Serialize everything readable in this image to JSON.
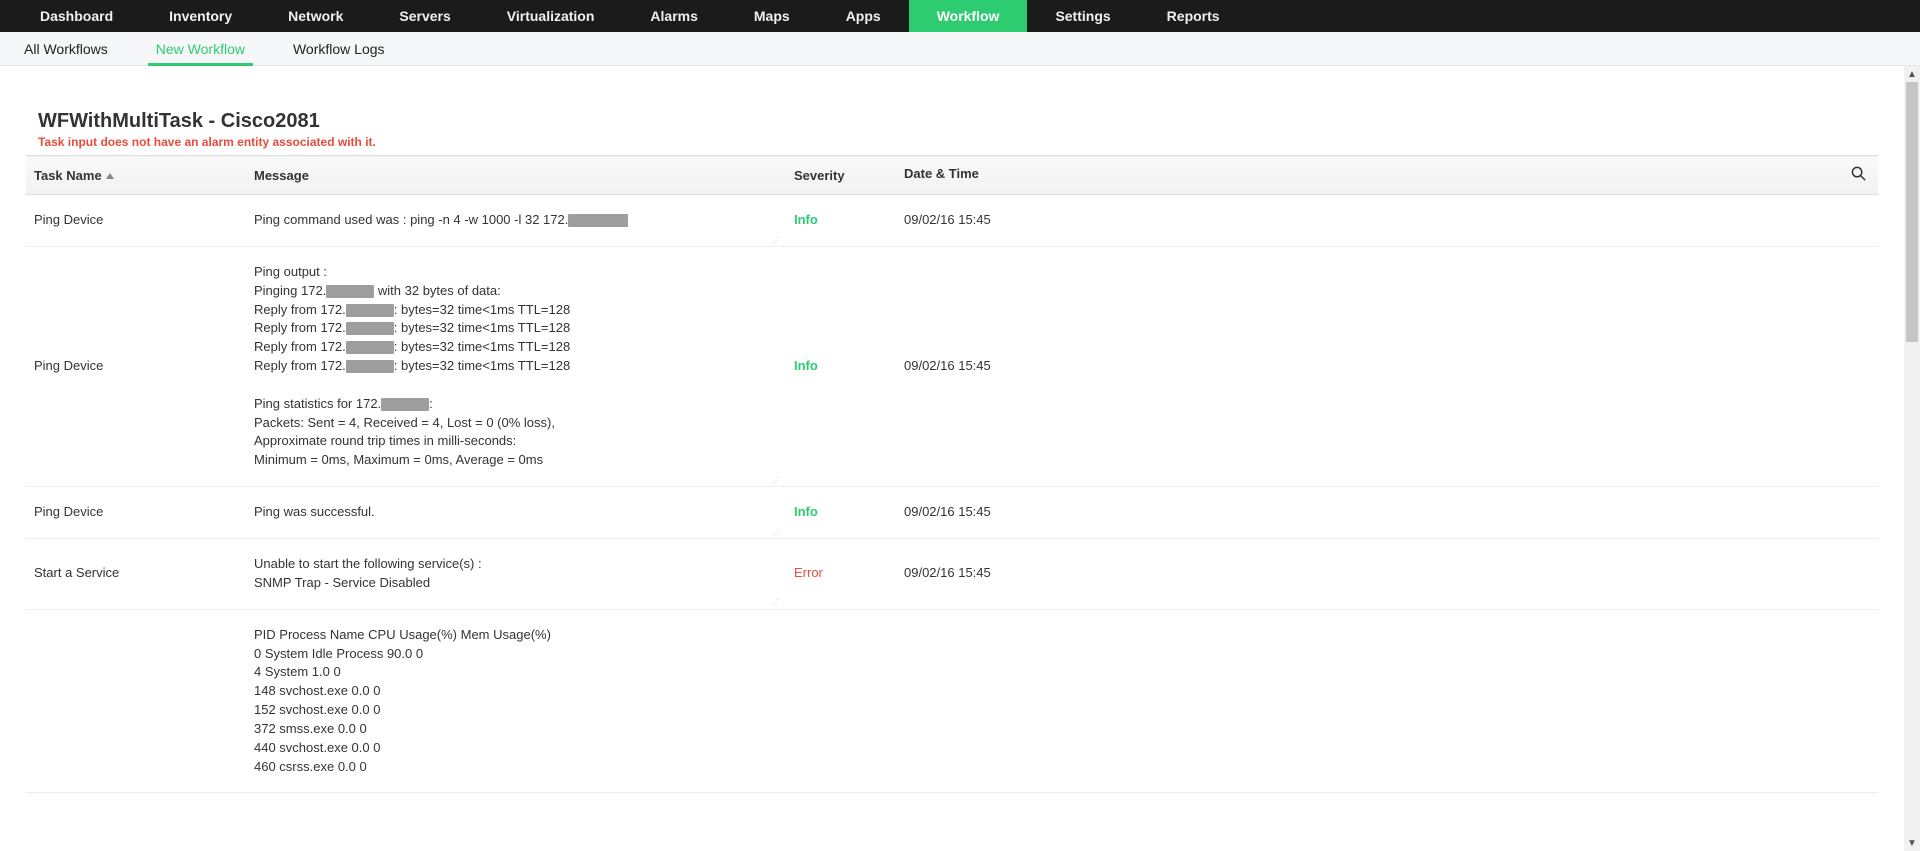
{
  "nav": {
    "items": [
      {
        "label": "Dashboard",
        "active": false
      },
      {
        "label": "Inventory",
        "active": false
      },
      {
        "label": "Network",
        "active": false
      },
      {
        "label": "Servers",
        "active": false
      },
      {
        "label": "Virtualization",
        "active": false
      },
      {
        "label": "Alarms",
        "active": false
      },
      {
        "label": "Maps",
        "active": false
      },
      {
        "label": "Apps",
        "active": false
      },
      {
        "label": "Workflow",
        "active": true
      },
      {
        "label": "Settings",
        "active": false
      },
      {
        "label": "Reports",
        "active": false
      }
    ]
  },
  "subnav": {
    "tabs": [
      {
        "label": "All Workflows",
        "active": false
      },
      {
        "label": "New Workflow",
        "active": true
      },
      {
        "label": "Workflow Logs",
        "active": false
      }
    ]
  },
  "page": {
    "title": "WFWithMultiTask - Cisco2081",
    "alert": "Task input does not have an alarm entity associated with it."
  },
  "columns": {
    "task": "Task Name",
    "message": "Message",
    "severity": "Severity",
    "datetime": "Date & Time"
  },
  "rows": [
    {
      "task": "Ping Device",
      "message": "Ping command used was : ping -n 4 -w 1000 -l 32 172.██████████",
      "severity": "Info",
      "severity_class": "sev-info",
      "datetime": "09/02/16 15:45"
    },
    {
      "task": "Ping Device",
      "message": "Ping output :\nPinging 172.████████ with 32 bytes of data:\nReply from 172.████████: bytes=32 time<1ms TTL=128\nReply from 172.████████: bytes=32 time<1ms TTL=128\nReply from 172.████████: bytes=32 time<1ms TTL=128\nReply from 172.████████: bytes=32 time<1ms TTL=128\n\nPing statistics for 172.████████:\n    Packets: Sent = 4, Received = 4, Lost = 0 (0% loss),\nApproximate round trip times in milli-seconds:\n    Minimum = 0ms, Maximum = 0ms, Average = 0ms",
      "severity": "Info",
      "severity_class": "sev-info",
      "datetime": "09/02/16 15:45"
    },
    {
      "task": "Ping Device",
      "message": "Ping was successful.",
      "severity": "Info",
      "severity_class": "sev-info",
      "datetime": "09/02/16 15:45"
    },
    {
      "task": "Start a Service",
      "message": "Unable to start the following service(s) :\nSNMP Trap - Service Disabled",
      "severity": "Error",
      "severity_class": "sev-error",
      "datetime": "09/02/16 15:45"
    },
    {
      "task": "",
      "message": "PID   Process Name   CPU Usage(%)   Mem Usage(%)\n0      System Idle Process  90.0  0\n4      System     1.0     0\n148   svchost.exe        0.0     0\n152   svchost.exe        0.0     0\n372   smss.exe  0.0     0\n440   svchost.exe        0.0     0\n460   csrss.exe  0.0     0",
      "severity": "",
      "severity_class": "",
      "datetime": ""
    }
  ],
  "icons": {
    "search": "search-icon"
  }
}
